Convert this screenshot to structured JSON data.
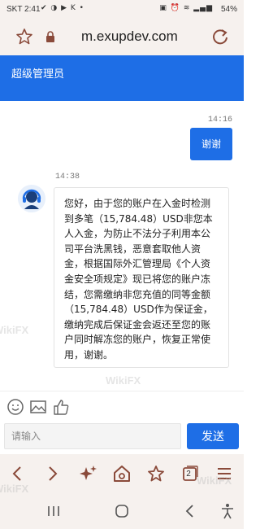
{
  "status_bar": {
    "time": "SKT 2:41",
    "left_icons": "✔ ◑ ▶ K •",
    "right_icons": "▣ ⏰ ≋ ▂▄▆",
    "battery": "54%"
  },
  "browser": {
    "url": "m.exupdev.com",
    "icons": [
      "star-icon",
      "lock-icon",
      "reload-icon"
    ]
  },
  "header": {
    "title": "超级管理员"
  },
  "chat": {
    "messages": [
      {
        "side": "right",
        "time": "14:16",
        "text": "谢谢"
      },
      {
        "side": "left",
        "time": "14:38",
        "text": "您好，由于您的账户在入金时检测到多笔（15,784.48）USD非您本人入金，为防止不法分子利用本公司平台洗黑钱，恶意套取他人资金，根据国际外汇管理局《个人资金安全项规定》现已将您的账户冻结，您需缴纳非您充值的同等金额（15,784.48）USD作为保证金，缴纳完成后保证金会返还至您的账户同时解冻您的账户，恢复正常使用，谢谢。"
      }
    ]
  },
  "toolbar": {
    "icons": [
      "emoji-icon",
      "image-icon",
      "thumbs-up-icon"
    ]
  },
  "composer": {
    "placeholder": "请输入",
    "send_label": "发送"
  },
  "browser_nav": {
    "tab_count": "2",
    "icons": [
      "back-icon",
      "forward-icon",
      "sparkle-icon",
      "home-icon",
      "bookmark-star-icon",
      "tabs-icon",
      "menu-icon"
    ]
  },
  "android_nav": {
    "icons": [
      "recents-icon",
      "home-circle-icon",
      "back-chevron-icon",
      "accessibility-icon"
    ]
  },
  "watermark": {
    "text": "WikiFX"
  },
  "colors": {
    "accent": "#1e6ee6",
    "icon_brown": "#8a4a3a",
    "bar_bg": "#f6f1ee"
  }
}
